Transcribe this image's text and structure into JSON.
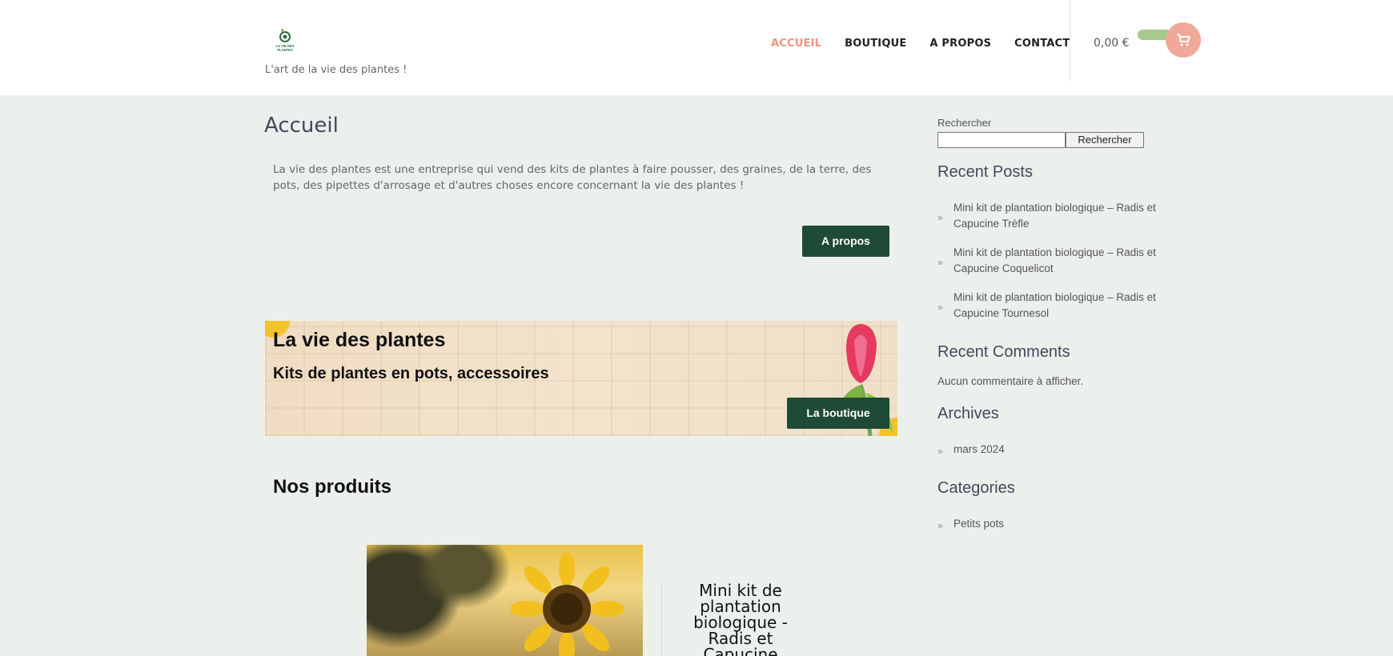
{
  "header": {
    "logo_text": "LA VIE DES PLANTES",
    "tagline": "L'art de la vie des plantes !",
    "nav": [
      {
        "label": "ACCUEIL",
        "active": true
      },
      {
        "label": "BOUTIQUE",
        "active": false
      },
      {
        "label": "A PROPOS",
        "active": false
      },
      {
        "label": "CONTACT",
        "active": false
      }
    ],
    "cart_total": "0,00 €",
    "accent_color": "#f0937f",
    "cart_icon": "cart-icon"
  },
  "main": {
    "title": "Accueil",
    "intro": "La vie des plantes est une entreprise qui vend des kits de plantes à faire pousser, des graines, de la terre, des pots, des pipettes d'arrosage et d'autres choses encore concernant la vie des plantes !",
    "apropos_button": "A propos",
    "banner": {
      "title": "La vie des plantes",
      "subtitle": "Kits de plantes en pots, accessoires",
      "button": "La boutique"
    },
    "products_heading": "Nos produits",
    "product": {
      "title": "Mini kit de plantation biologique - Radis et Capucine"
    },
    "button_color": "#1f4a35"
  },
  "sidebar": {
    "search_label": "Rechercher",
    "search_placeholder": "",
    "search_button": "Rechercher",
    "recent_posts_title": "Recent Posts",
    "recent_posts": [
      "Mini kit de plantation biologique – Radis et Capucine Trèfle",
      "Mini kit de plantation biologique – Radis et Capucine Coquelicot",
      "Mini kit de plantation biologique – Radis et Capucine Tournesol"
    ],
    "recent_comments_title": "Recent Comments",
    "no_comments": "Aucun commentaire à afficher.",
    "archives_title": "Archives",
    "archives": [
      "mars 2024"
    ],
    "categories_title": "Categories",
    "categories": [
      "Petits pots"
    ]
  }
}
